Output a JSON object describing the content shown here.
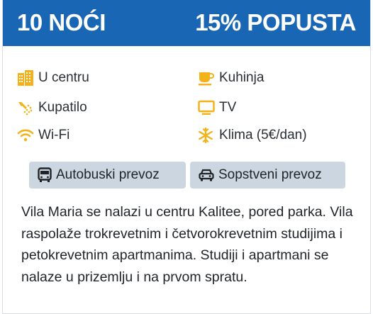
{
  "header": {
    "nights": "10 NOĆI",
    "discount": "15% POPUSTA",
    "background_color": "#1866b4"
  },
  "amenities": [
    {
      "label": "U centru",
      "icon": "building-icon"
    },
    {
      "label": "Kuhinja",
      "icon": "coffee-cup-icon"
    },
    {
      "label": "Kupatilo",
      "icon": "shower-icon"
    },
    {
      "label": "TV",
      "icon": "tv-icon"
    },
    {
      "label": "Wi-Fi",
      "icon": "wifi-icon"
    },
    {
      "label": "Klima (5€/dan)",
      "icon": "snowflake-icon"
    }
  ],
  "accent_color": "#f4b21a",
  "transport": [
    {
      "label": "Autobuski prevoz",
      "icon": "bus-icon"
    },
    {
      "label": "Sopstveni prevoz",
      "icon": "car-icon"
    }
  ],
  "description": "Vila Maria se nalazi u centru Kalitee, pored parka. Vila raspolaže trokrevetnim i četvorokrevetnim studijima i petokrevetnim apartmanima. Studiji i apartmani se nalaze u prizemlju i na prvom spratu."
}
